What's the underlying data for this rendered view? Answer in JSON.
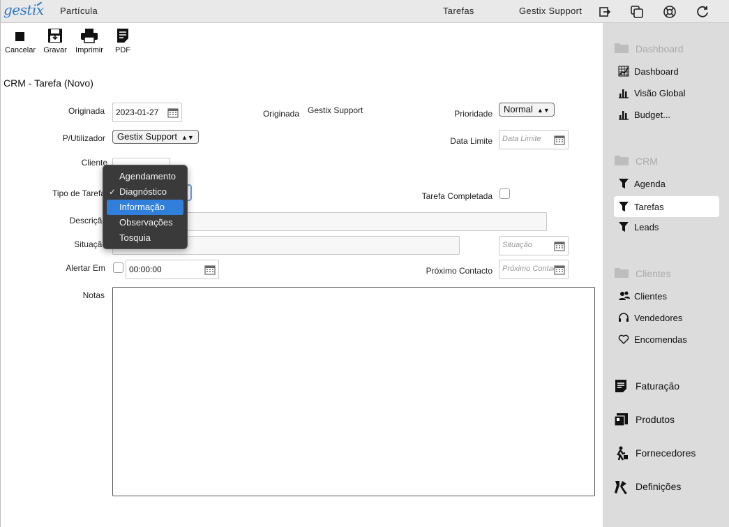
{
  "topbar": {
    "logo": "gestix",
    "company": "Partícula",
    "section": "Tarefas",
    "user": "Gestix Support"
  },
  "toolbar": {
    "cancel": "Cancelar",
    "save": "Gravar",
    "print": "Imprimir",
    "pdf": "PDF"
  },
  "page_title": "CRM - Tarefa (Novo)",
  "form": {
    "originada_date_label": "Originada",
    "originada_date_value": "2023-01-27",
    "originada_user_label": "Originada",
    "originada_user_value": "Gestix Support",
    "prioridade_label": "Prioridade",
    "prioridade_value": "Normal",
    "utilizador_label": "P/Utilizador",
    "utilizador_value": "Gestix Support",
    "data_limite_label": "Data Limite",
    "data_limite_placeholder": "Data Limite",
    "cliente_label": "Cliente",
    "tipo_label": "Tipo de Tarefa",
    "tarefa_completada_label": "Tarefa Completada",
    "descricao_label": "Descrição",
    "situacao_label": "Situação",
    "situacao_placeholder": "Situação",
    "alertar_label": "Alertar Em",
    "alertar_time": "00:00:00",
    "proximo_label": "Próximo Contacto",
    "proximo_placeholder": "Próximo Contacto",
    "notas_label": "Notas"
  },
  "tipo_menu": {
    "options": [
      "Agendamento",
      "Diagnóstico",
      "Informação",
      "Observações",
      "Tosquia"
    ],
    "checked": "Diagnóstico",
    "highlighted": "Informação"
  },
  "sidebar": {
    "dashboard_section": "Dashboard",
    "dashboard_items": [
      "Dashboard",
      "Visão Global",
      "Budget..."
    ],
    "crm_section": "CRM",
    "crm_items": [
      "Agenda",
      "Tarefas",
      "Leads"
    ],
    "clientes_section": "Clientes",
    "clientes_items": [
      "Clientes",
      "Vendedores",
      "Encomendas"
    ],
    "faturacao": "Faturação",
    "produtos": "Produtos",
    "fornecedores": "Fornecedores",
    "definicoes": "Definições"
  },
  "colors": {
    "brand": "#2e7bc4",
    "highlight": "#2f7fdb",
    "sidebar_bg": "#dcdcdc",
    "topbar_bg": "#e9e9e9"
  }
}
